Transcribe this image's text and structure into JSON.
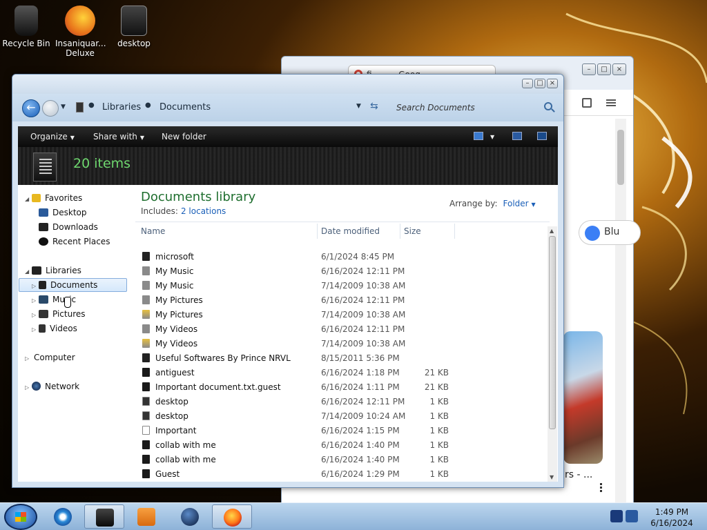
{
  "desktop": {
    "icons": [
      {
        "label": "Recycle Bin"
      },
      {
        "label": "Insaniquar... Deluxe"
      },
      {
        "label": "desktop"
      }
    ]
  },
  "bg_window": {
    "tab_label": "fi... - ... Goog...",
    "chip_label": "Blu",
    "caption": "rs - ..."
  },
  "explorer": {
    "breadcrumb": [
      "Libraries",
      "Documents"
    ],
    "search_placeholder": "Search Documents",
    "toolbar": {
      "organize": "Organize",
      "share_with": "Share with",
      "new_folder": "New folder"
    },
    "item_count": "20 items",
    "nav": {
      "favorites": "Favorites",
      "favorites_items": [
        "Desktop",
        "Downloads",
        "Recent Places"
      ],
      "libraries": "Libraries",
      "libraries_items": [
        "Documents",
        "Music",
        "Pictures",
        "Videos"
      ],
      "computer": "Computer",
      "network": "Network"
    },
    "library": {
      "title": "Documents library",
      "includes_label": "Includes:",
      "includes_link": "2 locations",
      "arrange_label": "Arrange by:",
      "arrange_value": "Folder"
    },
    "columns": {
      "name": "Name",
      "date": "Date modified",
      "size": "Size"
    },
    "files": [
      {
        "name": "microsoft",
        "date": "6/1/2024 8:45 PM",
        "size": "",
        "icon": "folder-dark-icon"
      },
      {
        "name": "My Music",
        "date": "6/16/2024 12:11 PM",
        "size": "",
        "icon": "folder-gray-icon"
      },
      {
        "name": "My Music",
        "date": "7/14/2009 10:38 AM",
        "size": "",
        "icon": "folder-gray-icon"
      },
      {
        "name": "My Pictures",
        "date": "6/16/2024 12:11 PM",
        "size": "",
        "icon": "folder-gray-icon"
      },
      {
        "name": "My Pictures",
        "date": "7/14/2009 10:38 AM",
        "size": "",
        "icon": "folder-locked-icon"
      },
      {
        "name": "My Videos",
        "date": "6/16/2024 12:11 PM",
        "size": "",
        "icon": "folder-gray-icon"
      },
      {
        "name": "My Videos",
        "date": "7/14/2009 10:38 AM",
        "size": "",
        "icon": "folder-locked-icon"
      },
      {
        "name": "Useful Softwares By Prince NRVL",
        "date": "8/15/2011 5:36 PM",
        "size": "",
        "icon": "folder-dark-icon"
      },
      {
        "name": "antiguest",
        "date": "6/16/2024 1:18 PM",
        "size": "21 KB",
        "icon": "file-dark-icon"
      },
      {
        "name": "Important document.txt.guest",
        "date": "6/16/2024 1:11 PM",
        "size": "21 KB",
        "icon": "file-dark-icon"
      },
      {
        "name": "desktop",
        "date": "6/16/2024 12:11 PM",
        "size": "1 KB",
        "icon": "settings-file-icon"
      },
      {
        "name": "desktop",
        "date": "7/14/2009 10:24 AM",
        "size": "1 KB",
        "icon": "settings-file-icon"
      },
      {
        "name": "Important",
        "date": "6/16/2024 1:15 PM",
        "size": "1 KB",
        "icon": "text-file-icon"
      },
      {
        "name": "collab with me",
        "date": "6/16/2024 1:40 PM",
        "size": "1 KB",
        "icon": "file-dark-icon"
      },
      {
        "name": "collab with me",
        "date": "6/16/2024 1:40 PM",
        "size": "1 KB",
        "icon": "file-dark-icon"
      },
      {
        "name": "Guest",
        "date": "6/16/2024 1:29 PM",
        "size": "1 KB",
        "icon": "file-dark-icon"
      }
    ]
  },
  "taskbar": {
    "time": "1:49 PM",
    "date": "6/16/2024"
  },
  "colors": {
    "accent_green": "#1e6e2e",
    "link_blue": "#1a5fb8",
    "item_count_green": "#6fd86f"
  }
}
